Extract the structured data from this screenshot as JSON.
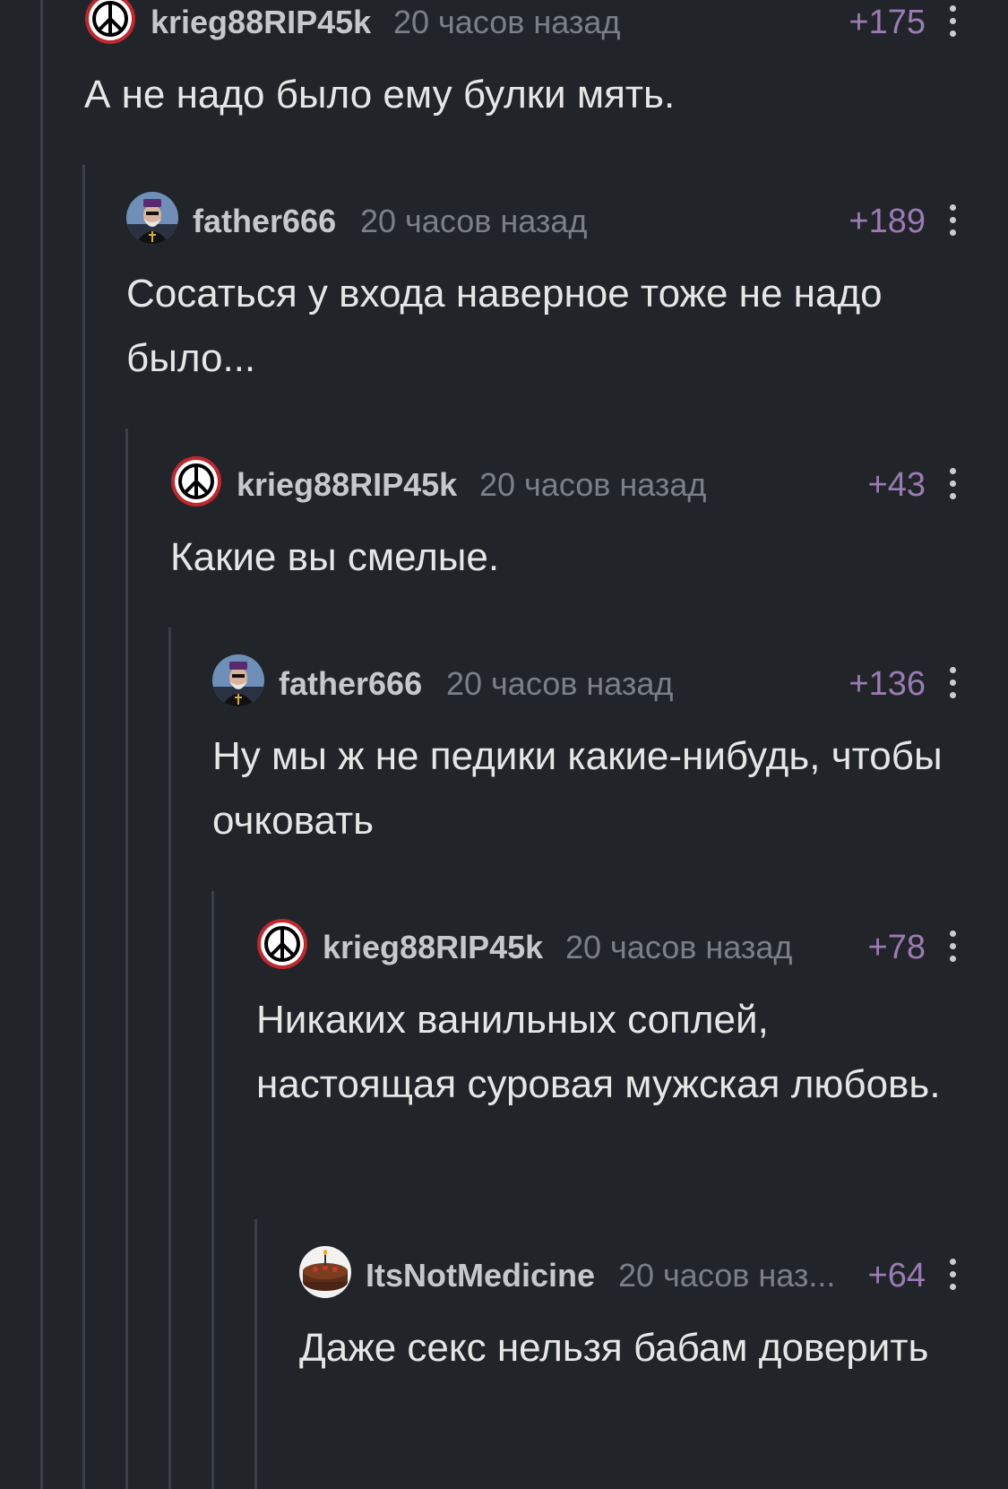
{
  "comments": [
    {
      "username": "krieg88RIP45k",
      "time": "20 часов назад",
      "rating": "+175",
      "text": "А не надо было ему булки мять.",
      "avatar": "peace-sign-avatar"
    },
    {
      "username": "father666",
      "time": "20 часов назад",
      "rating": "+189",
      "text": "Сосаться у входа наверное тоже не надо было...",
      "avatar": "priest-avatar"
    },
    {
      "username": "krieg88RIP45k",
      "time": "20 часов назад",
      "rating": "+43",
      "text": "Какие вы смелые.",
      "avatar": "peace-sign-avatar"
    },
    {
      "username": "father666",
      "time": "20 часов назад",
      "rating": "+136",
      "text": "Ну мы ж не педики какие-нибудь, чтобы очковать",
      "avatar": "priest-avatar"
    },
    {
      "username": "krieg88RIP45k",
      "time": "20 часов назад",
      "rating": "+78",
      "text": "Никаких ванильных соплей, настоящая суровая мужская любовь.",
      "avatar": "peace-sign-avatar"
    },
    {
      "username": "ItsNotMedicine",
      "time": "20 часов наз...",
      "rating": "+64",
      "text": "Даже секс нельзя бабам доверить",
      "avatar": "cake-avatar"
    }
  ],
  "colors": {
    "background": "#212529",
    "thread_line": "#3a3f45",
    "rating": "#9b7bb3",
    "username": "#c5c9ce",
    "time": "#7b8087",
    "text": "#e6e6e6"
  }
}
